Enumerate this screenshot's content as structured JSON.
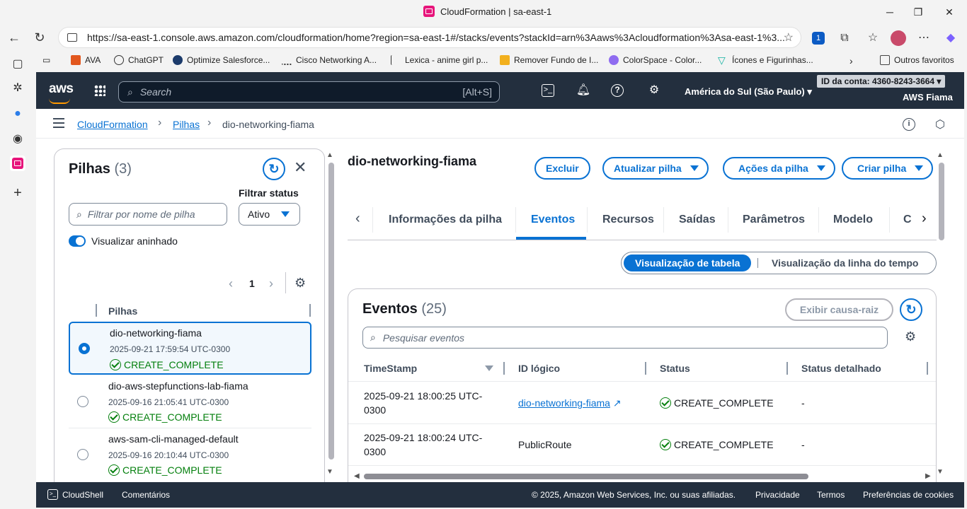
{
  "browser": {
    "window_title": "CloudFormation | sa-east-1",
    "url": "https://sa-east-1.console.aws.amazon.com/cloudformation/home?region=sa-east-1#/stacks/events?stackId=arn%3Aaws%3Acloudformation%3Asa-east-1%3...",
    "bookmarks": [
      "AVA",
      "ChatGPT",
      "Optimize Salesforce...",
      "Cisco Networking A...",
      "Lexica - anime girl p...",
      "Remover Fundo de I...",
      "ColorSpace - Color...",
      "Ícones e Figurinhas..."
    ],
    "other_favorites": "Outros favoritos",
    "badge_count": "1"
  },
  "aws_header": {
    "logo": "aws",
    "search_placeholder": "Search",
    "search_shortcut": "[Alt+S]",
    "region": "América do Sul (São Paulo)",
    "account": "ID da conta: 4360-8243-3664",
    "user": "AWS Fiama"
  },
  "breadcrumb": {
    "items": [
      "CloudFormation",
      "Pilhas",
      "dio-networking-fiama"
    ]
  },
  "stacks_panel": {
    "title": "Pilhas",
    "count": "(3)",
    "filter_placeholder": "Filtrar por nome de pilha",
    "filter_status_label": "Filtrar status",
    "filter_status_value": "Ativo",
    "nested_toggle_label": "Visualizar aninhado",
    "page": "1",
    "column_header": "Pilhas",
    "stacks": [
      {
        "name": "dio-networking-fiama",
        "date": "2025-09-21 17:59:54 UTC-0300",
        "status": "CREATE_COMPLETE"
      },
      {
        "name": "dio-aws-stepfunctions-lab-fiama",
        "date": "2025-09-16 21:05:41 UTC-0300",
        "status": "CREATE_COMPLETE"
      },
      {
        "name": "aws-sam-cli-managed-default",
        "date": "2025-09-16 20:10:44 UTC-0300",
        "status": "CREATE_COMPLETE"
      }
    ]
  },
  "detail": {
    "title": "dio-networking-fiama",
    "buttons": {
      "delete": "Excluir",
      "update": "Atualizar pilha",
      "actions": "Ações da pilha",
      "create": "Criar pilha"
    },
    "tabs": [
      "Informações da pilha",
      "Eventos",
      "Recursos",
      "Saídas",
      "Parâmetros",
      "Modelo",
      "C"
    ],
    "view_table": "Visualização de tabela",
    "view_timeline": "Visualização da linha do tempo",
    "events": {
      "title": "Eventos",
      "count": "(25)",
      "root_cause_button": "Exibir causa-raiz",
      "search_placeholder": "Pesquisar eventos",
      "columns": [
        "TimeStamp",
        "ID lógico",
        "Status",
        "Status detalhado"
      ],
      "rows": [
        {
          "timestamp_1": "2025-09-21 18:00:25 UTC-",
          "timestamp_2": "0300",
          "logical_id": "dio-networking-fiama",
          "status": "CREATE_COMPLETE",
          "detail": "-"
        },
        {
          "timestamp_1": "2025-09-21 18:00:24 UTC-",
          "timestamp_2": "0300",
          "logical_id": "PublicRoute",
          "status": "CREATE_COMPLETE",
          "detail": "-"
        }
      ]
    }
  },
  "footer": {
    "cloudshell": "CloudShell",
    "feedback": "Comentários",
    "copyright": "© 2025, Amazon Web Services, Inc. ou suas afiliadas.",
    "privacy": "Privacidade",
    "terms": "Termos",
    "cookies": "Preferências de cookies"
  }
}
